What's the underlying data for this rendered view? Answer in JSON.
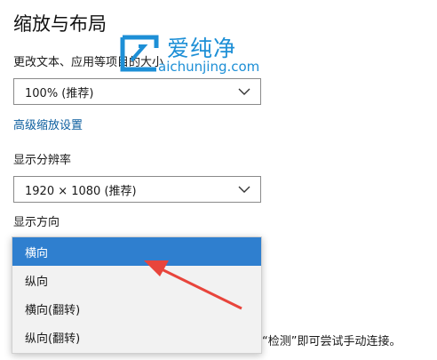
{
  "scale_layout": {
    "title": "缩放与布局",
    "text_size_label": "更改文本、应用等项目的大小",
    "scale_select": {
      "value": "100% (推荐)"
    },
    "advanced_link": "高级缩放设置",
    "resolution_label": "显示分辨率",
    "resolution_select": {
      "value": "1920 × 1080 (推荐)"
    },
    "orientation_label": "显示方向",
    "orientation_dropdown": {
      "options": [
        "横向",
        "纵向",
        "横向(翻转)",
        "纵向(翻转)"
      ],
      "selected": "横向"
    }
  },
  "detect_hint": "“检测”即可尝试手动连接。",
  "watermark": {
    "name": "爱纯净",
    "url": "aichunjing.com"
  },
  "colors": {
    "accent": "#2f7fcf",
    "link": "#0b5d9e",
    "watermark": "#1d8fd6",
    "annotation_arrow": "#e8453c"
  }
}
